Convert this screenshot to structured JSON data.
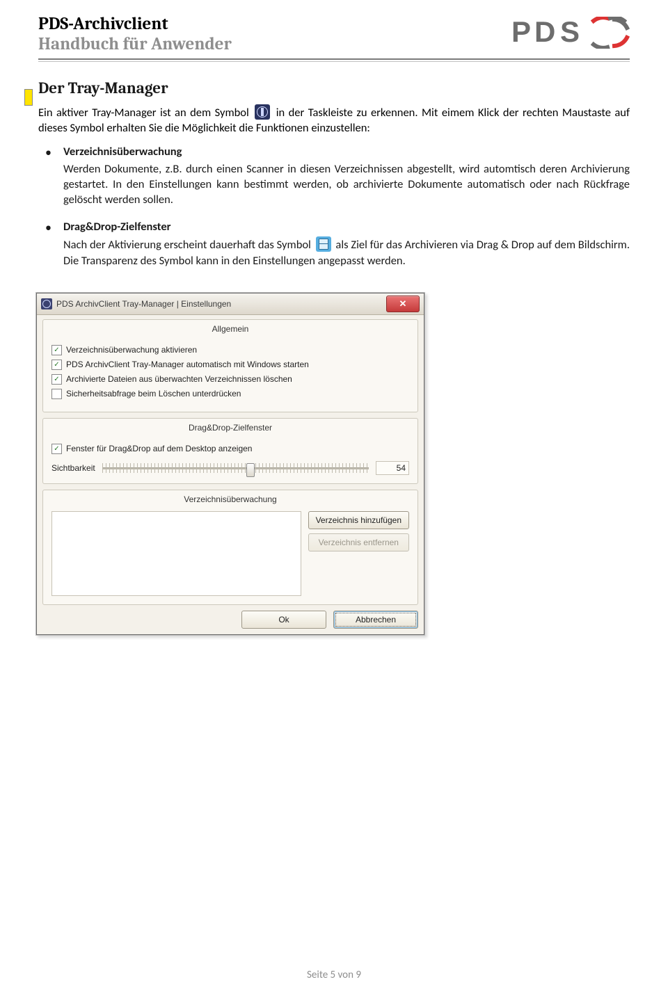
{
  "header": {
    "line1": "PDS-Archivclient",
    "line2": "Handbuch für Anwender",
    "logo_text": "PDS"
  },
  "section": {
    "title": "Der Tray-Manager"
  },
  "intro": {
    "t1": "Ein aktiver Tray-Manager ist an dem Symbol ",
    "t2": " in der Taskleiste zu erkennen. Mit eimem Klick der rechten Maustaste auf dieses Symbol erhalten Sie die Möglichkeit die Funktionen einzustellen:"
  },
  "bullets": [
    {
      "title": "Verzeichnisüberwachung",
      "p1": "Werden Dokumente, z.B. durch einen Scanner in diesen Verzeichnissen abgestellt, wird automtisch deren Archivierung gestartet. In den Einstellungen kann bestimmt werden, ob archivierte Dokumente automatisch oder nach Rückfrage gelöscht werden sollen."
    },
    {
      "title": "Drag&Drop-Zielfenster",
      "p_a": "Nach der Aktivierung erscheint dauerhaft das  Symbol ",
      "p_b": " als Ziel für das Archivieren via Drag & Drop auf dem Bildschirm. Die Transparenz des Symbol kann in den Einstellungen angepasst werden."
    }
  ],
  "dialog": {
    "title": "PDS ArchivClient Tray-Manager | Einstellungen",
    "groups": {
      "g1": {
        "title": "Allgemein",
        "cb": [
          {
            "checked": true,
            "label": "Verzeichnisüberwachung aktivieren"
          },
          {
            "checked": true,
            "label": "PDS ArchivClient Tray-Manager automatisch mit Windows starten"
          },
          {
            "checked": true,
            "label": "Archivierte Dateien aus überwachten Verzeichnissen löschen"
          },
          {
            "checked": false,
            "label": "Sicherheitsabfrage beim Löschen unterdrücken"
          }
        ]
      },
      "g2": {
        "title": "Drag&Drop-Zielfenster",
        "cb": [
          {
            "checked": true,
            "label": "Fenster für Drag&Drop auf dem Desktop anzeigen"
          }
        ],
        "slider_label": "Sichtbarkeit",
        "slider_value": "54"
      },
      "g3": {
        "title": "Verzeichnisüberwachung",
        "btn_add": "Verzeichnis hinzufügen",
        "btn_del": "Verzeichnis entfernen"
      }
    },
    "ok": "Ok",
    "cancel": "Abbrechen"
  },
  "footer": "Seite 5 von 9"
}
